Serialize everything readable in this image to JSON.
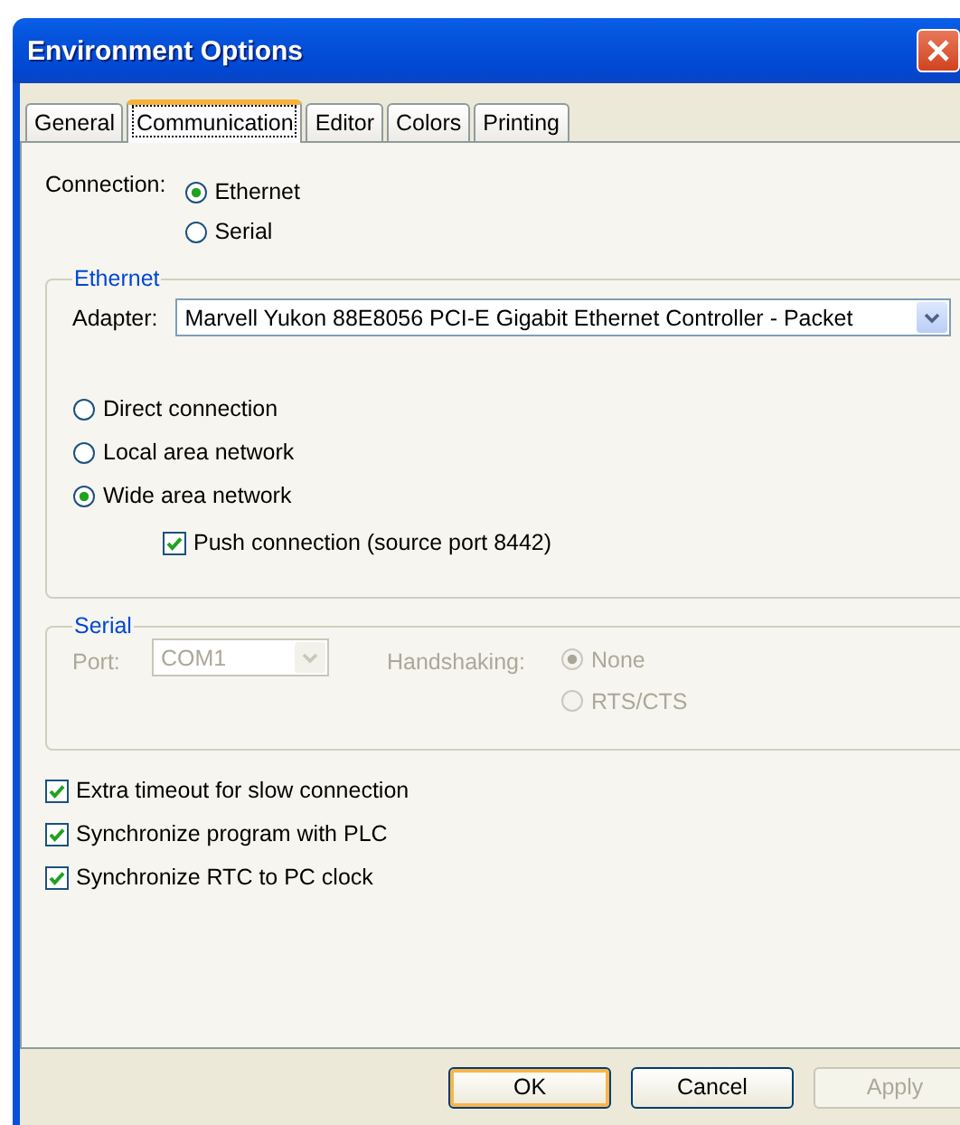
{
  "window": {
    "title": "Environment Options"
  },
  "tabs": [
    {
      "label": "General",
      "selected": false
    },
    {
      "label": "Communication",
      "selected": true
    },
    {
      "label": "Editor",
      "selected": false
    },
    {
      "label": "Colors",
      "selected": false
    },
    {
      "label": "Printing",
      "selected": false
    }
  ],
  "connection": {
    "label": "Connection:",
    "options": [
      {
        "label": "Ethernet",
        "selected": true
      },
      {
        "label": "Serial",
        "selected": false
      }
    ]
  },
  "ethernet": {
    "title": "Ethernet",
    "adapter_label": "Adapter:",
    "adapter_value": "Marvell Yukon 88E8056 PCI-E Gigabit Ethernet Controller - Packet",
    "options": [
      {
        "label": "Direct connection",
        "selected": false
      },
      {
        "label": "Local area network",
        "selected": false
      },
      {
        "label": "Wide area network",
        "selected": true
      }
    ],
    "push": {
      "label": "Push connection (source port 8442)",
      "checked": true
    }
  },
  "serial": {
    "title": "Serial",
    "disabled": true,
    "port_label": "Port:",
    "port_value": "COM1",
    "handshaking_label": "Handshaking:",
    "handshaking": [
      {
        "label": "None",
        "selected": true
      },
      {
        "label": "RTS/CTS",
        "selected": false
      }
    ]
  },
  "options": [
    {
      "label": "Extra timeout for slow connection",
      "checked": true
    },
    {
      "label": "Synchronize program with PLC",
      "checked": true
    },
    {
      "label": "Synchronize RTC to PC clock",
      "checked": true
    }
  ],
  "buttons": [
    {
      "label": "OK",
      "default": true,
      "disabled": false
    },
    {
      "label": "Cancel",
      "default": false,
      "disabled": false
    },
    {
      "label": "Apply",
      "default": false,
      "disabled": true
    }
  ]
}
